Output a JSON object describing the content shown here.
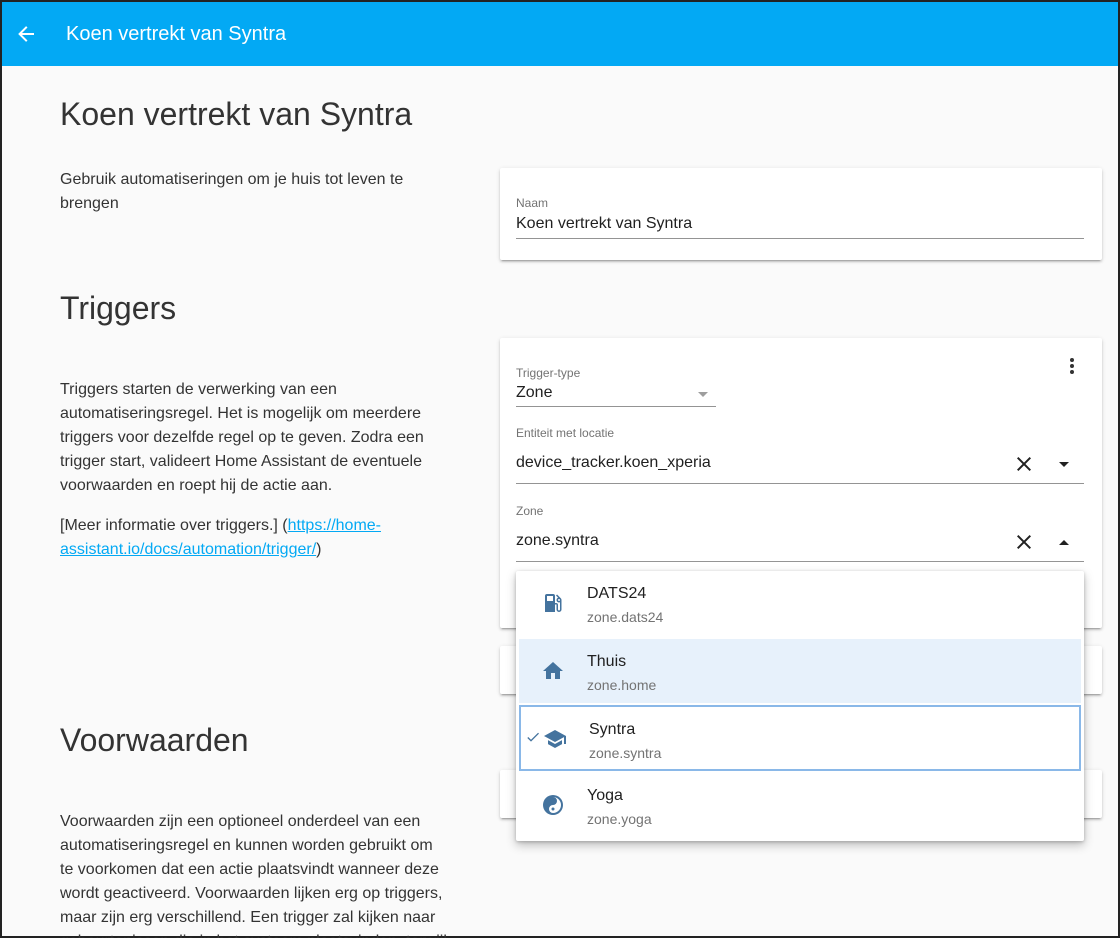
{
  "appbar": {
    "title": "Koen vertrekt van Syntra"
  },
  "header": {
    "title": "Koen vertrekt van Syntra",
    "description": "Gebruik automatiseringen om je huis tot leven te brengen"
  },
  "name_card": {
    "label": "Naam",
    "value": "Koen vertrekt van Syntra"
  },
  "triggers": {
    "title": "Triggers",
    "description": "Triggers starten de verwerking van een automatiseringsregel. Het is mogelijk om meerdere triggers voor dezelfde regel op te geven. Zodra een trigger start, valideert Home Assistant de eventuele voorwaarden en roept hij de actie aan.",
    "more_info_prefix": "[Meer informatie over triggers.] (",
    "more_info_link": "https://home-assistant.io/docs/automation/trigger/",
    "more_info_suffix": ")",
    "card": {
      "type_label": "Trigger-type",
      "type_value": "Zone",
      "entity_label": "Entiteit met locatie",
      "entity_value": "device_tracker.koen_xperia",
      "zone_label": "Zone",
      "zone_value": "zone.syntra"
    }
  },
  "zone_options": [
    {
      "name": "DATS24",
      "id": "zone.dats24",
      "icon": "gas-station-icon"
    },
    {
      "name": "Thuis",
      "id": "zone.home",
      "icon": "home-icon"
    },
    {
      "name": "Syntra",
      "id": "zone.syntra",
      "icon": "school-icon",
      "selected": true
    },
    {
      "name": "Yoga",
      "id": "zone.yoga",
      "icon": "yin-yang-icon"
    }
  ],
  "conditions": {
    "title": "Voorwaarden",
    "description": "Voorwaarden zijn een optioneel onderdeel van een automatiseringsregel en kunnen worden gebruikt om te voorkomen dat een actie plaatsvindt wanneer deze wordt geactiveerd. Voorwaarden lijken erg op triggers, maar zijn erg verschillend. Een trigger zal kijken naar gebeurtenissen die in het systeem plaatsvinden, terwijl"
  },
  "colors": {
    "primary": "#03a9f4",
    "icon": "#44739e",
    "hover": "#e7f1fb"
  }
}
